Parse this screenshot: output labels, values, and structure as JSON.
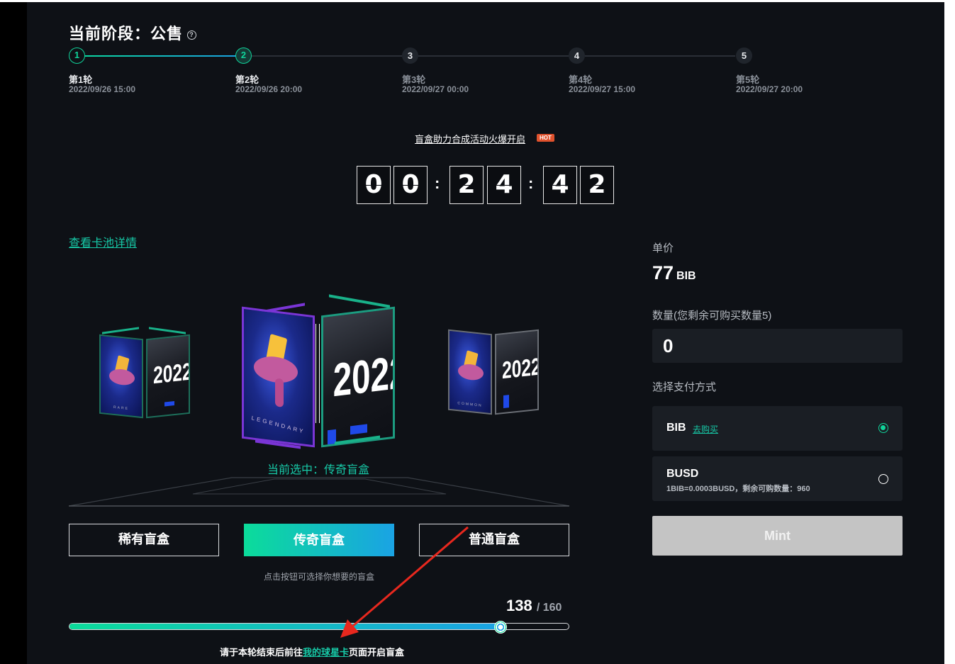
{
  "phase": {
    "title": "当前阶段：公售",
    "help_icon": "question-circle-icon"
  },
  "steps": [
    {
      "num": "1",
      "label": "第1轮",
      "date": "2022/09/26 15:00",
      "state": "done"
    },
    {
      "num": "2",
      "label": "第2轮",
      "date": "2022/09/26 20:00",
      "state": "current"
    },
    {
      "num": "3",
      "label": "第3轮",
      "date": "2022/09/27 00:00",
      "state": "pending"
    },
    {
      "num": "4",
      "label": "第4轮",
      "date": "2022/09/27 15:00",
      "state": "pending"
    },
    {
      "num": "5",
      "label": "第5轮",
      "date": "2022/09/27 20:00",
      "state": "pending"
    }
  ],
  "promo": {
    "text": "盲盒助力合成活动火爆开启",
    "badge": "HOT"
  },
  "countdown": {
    "digits": [
      "0",
      "0",
      "2",
      "4",
      "4",
      "2"
    ],
    "separator": ":"
  },
  "pool_link": "查看卡池详情",
  "boxes": {
    "year": "2022",
    "left_tag": "RARE",
    "center_tag": "LEGENDARY",
    "right_tag": "COMMON",
    "selected_text": "当前选中：传奇盲盒"
  },
  "selector": {
    "buttons": [
      {
        "label": "稀有盲盒",
        "active": false
      },
      {
        "label": "传奇盲盒",
        "active": true
      },
      {
        "label": "普通盲盒",
        "active": false
      }
    ],
    "hint": "点击按钮可选择你想要的盲盒"
  },
  "progress": {
    "sold": "138",
    "total": "/ 160",
    "fraction": 0.8625
  },
  "footer": {
    "prefix": "请于本轮结束后前往",
    "link": "我的球星卡",
    "suffix": "页面开启盲盒"
  },
  "purchase": {
    "price_label": "单价",
    "price_value": "77",
    "price_unit": "BIB",
    "qty_label": "数量(您剩余可购买数量5)",
    "qty_value": "0",
    "pay_label": "选择支付方式",
    "methods": [
      {
        "name": "BIB",
        "buy_link": "去购买",
        "selected": true
      },
      {
        "name": "BUSD",
        "note": "1BIB=0.0003BUSD，剩余可购数量：960",
        "selected": false
      }
    ],
    "mint_label": "Mint"
  },
  "colors": {
    "accent": "#10d39a",
    "accent2": "#1aa3e4",
    "bg": "#0e1116",
    "panel": "#1a1e24",
    "hot": "#e0522d",
    "annotation": "#e8281e"
  }
}
